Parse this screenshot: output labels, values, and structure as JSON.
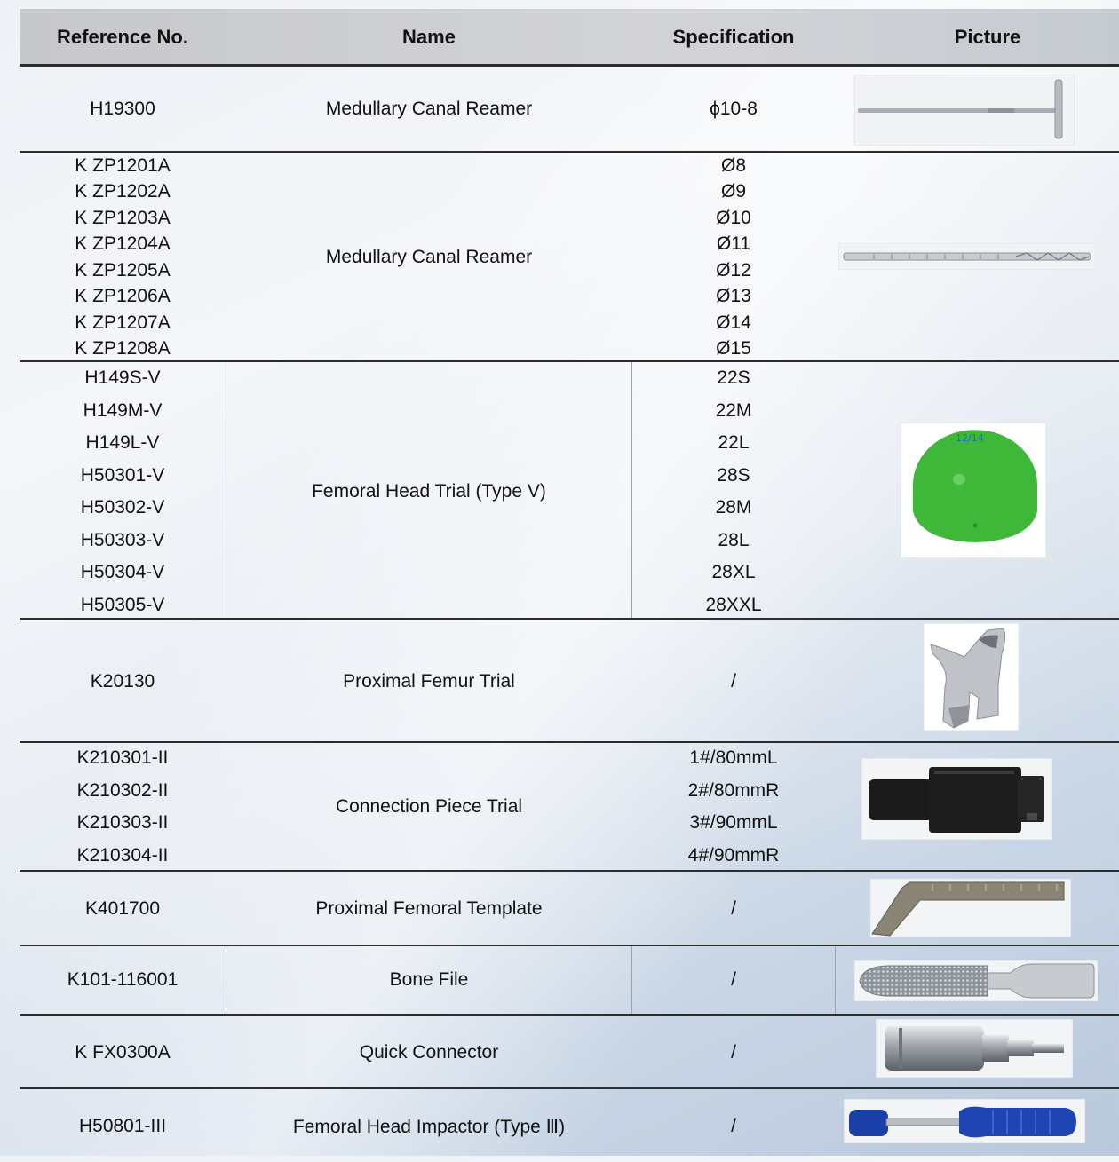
{
  "headers": {
    "ref": "Reference No.",
    "name": "Name",
    "spec": "Specification",
    "picture": "Picture"
  },
  "rows": [
    {
      "refs": [
        "H19300"
      ],
      "name": "Medullary Canal Reamer",
      "specs": [
        "ϕ10-8"
      ],
      "picture": "t-handle-reamer-image"
    },
    {
      "refs": [
        "K ZP1201A",
        "K ZP1202A",
        "K ZP1203A",
        "K ZP1204A",
        "K ZP1205A",
        "K ZP1206A",
        "K ZP1207A",
        "K ZP1208A"
      ],
      "name": "Medullary Canal Reamer",
      "specs": [
        "Ø8",
        "Ø9",
        "Ø10",
        "Ø11",
        "Ø12",
        "Ø13",
        "Ø14",
        "Ø15"
      ],
      "picture": "reamer-rod-image"
    },
    {
      "refs": [
        "H149S-V",
        "H149M-V",
        "H149L-V",
        "H50301-V",
        "H50302-V",
        "H50303-V",
        "H50304-V",
        "H50305-V"
      ],
      "name": "Femoral Head Trial (Type V)",
      "specs": [
        "22S",
        "22M",
        "22L",
        "28S",
        "28M",
        "28L",
        "28XL",
        "28XXL"
      ],
      "picture": "green-femoral-head-image",
      "head_label": "12/14"
    },
    {
      "refs": [
        "K20130"
      ],
      "name": "Proximal Femur Trial",
      "specs": [
        "/"
      ],
      "picture": "femur-trial-image"
    },
    {
      "refs": [
        "K210301-II",
        "K210302-II",
        "K210303-II",
        "K210304-II"
      ],
      "name": "Connection Piece Trial",
      "specs": [
        "1#/80mmL",
        "2#/80mmR",
        "3#/90mmL",
        "4#/90mmR"
      ],
      "picture": "black-connector-image"
    },
    {
      "refs": [
        "K401700"
      ],
      "name": "Proximal Femoral Template",
      "specs": [
        "/"
      ],
      "picture": "template-image"
    },
    {
      "refs": [
        "K101-116001"
      ],
      "name": "Bone File",
      "specs": [
        "/"
      ],
      "picture": "bone-file-image"
    },
    {
      "refs": [
        "K FX0300A"
      ],
      "name": "Quick Connector",
      "specs": [
        "/"
      ],
      "picture": "quick-connector-image"
    },
    {
      "refs": [
        "H50801-III"
      ],
      "name": "Femoral Head Impactor (Type Ⅲ)",
      "specs": [
        "/"
      ],
      "picture": "impactor-image"
    }
  ],
  "colors": {
    "header_bg": "#c9cacd",
    "rule": "#2d2d2d",
    "trial_head_green": "#3fb83a",
    "connector_black": "#1b1b1b",
    "impactor_blue": "#1b3fa8"
  }
}
